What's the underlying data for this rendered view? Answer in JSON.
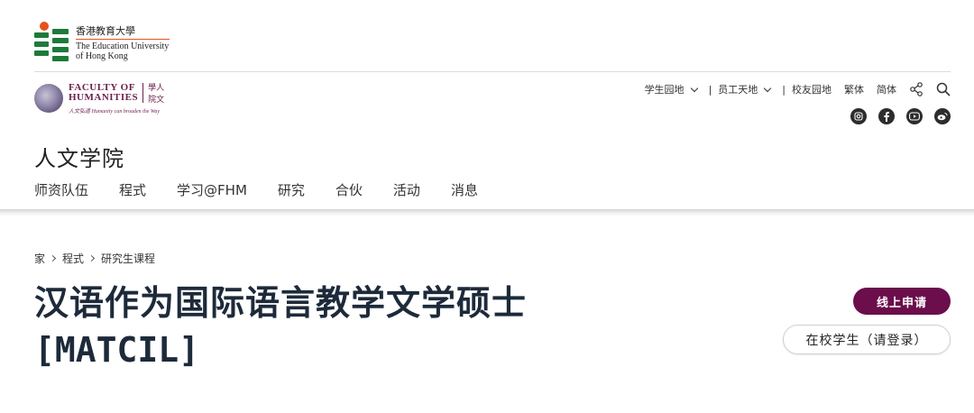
{
  "eduhk_logo": {
    "name_cn": "香港教育大學",
    "name_en_line1": "The Education University",
    "name_en_line2": "of Hong Kong"
  },
  "faculty_logo": {
    "name_en_line1": "FACULTY OF",
    "name_en_line2": "HUMANITIES",
    "name_cn_line1": "學人",
    "name_cn_line2": "院文",
    "tagline": "人文弘道 Humanity can broaden the Way"
  },
  "utility_nav": {
    "student_area": "学生园地",
    "staff_area": "员工天地",
    "alumni_area": "校友园地",
    "traditional": "繁体",
    "simplified": "简体"
  },
  "faculty_title": "人文学院",
  "main_nav": [
    "师资队伍",
    "程式",
    "学习@FHM",
    "研究",
    "合伙",
    "活动",
    "消息"
  ],
  "breadcrumb": [
    "家",
    "程式",
    "研究生课程"
  ],
  "page_title": {
    "line1": "汉语作为国际语言教学文学硕士",
    "line2": "[MATCIL]"
  },
  "buttons": {
    "apply": "线上申请",
    "login": "在校学生（请登录）"
  },
  "colors": {
    "brand_maroon": "#6b0e4b",
    "eduhk_green": "#1e7a3a",
    "eduhk_orange": "#e2541b",
    "title_navy": "#1d2a3a"
  }
}
